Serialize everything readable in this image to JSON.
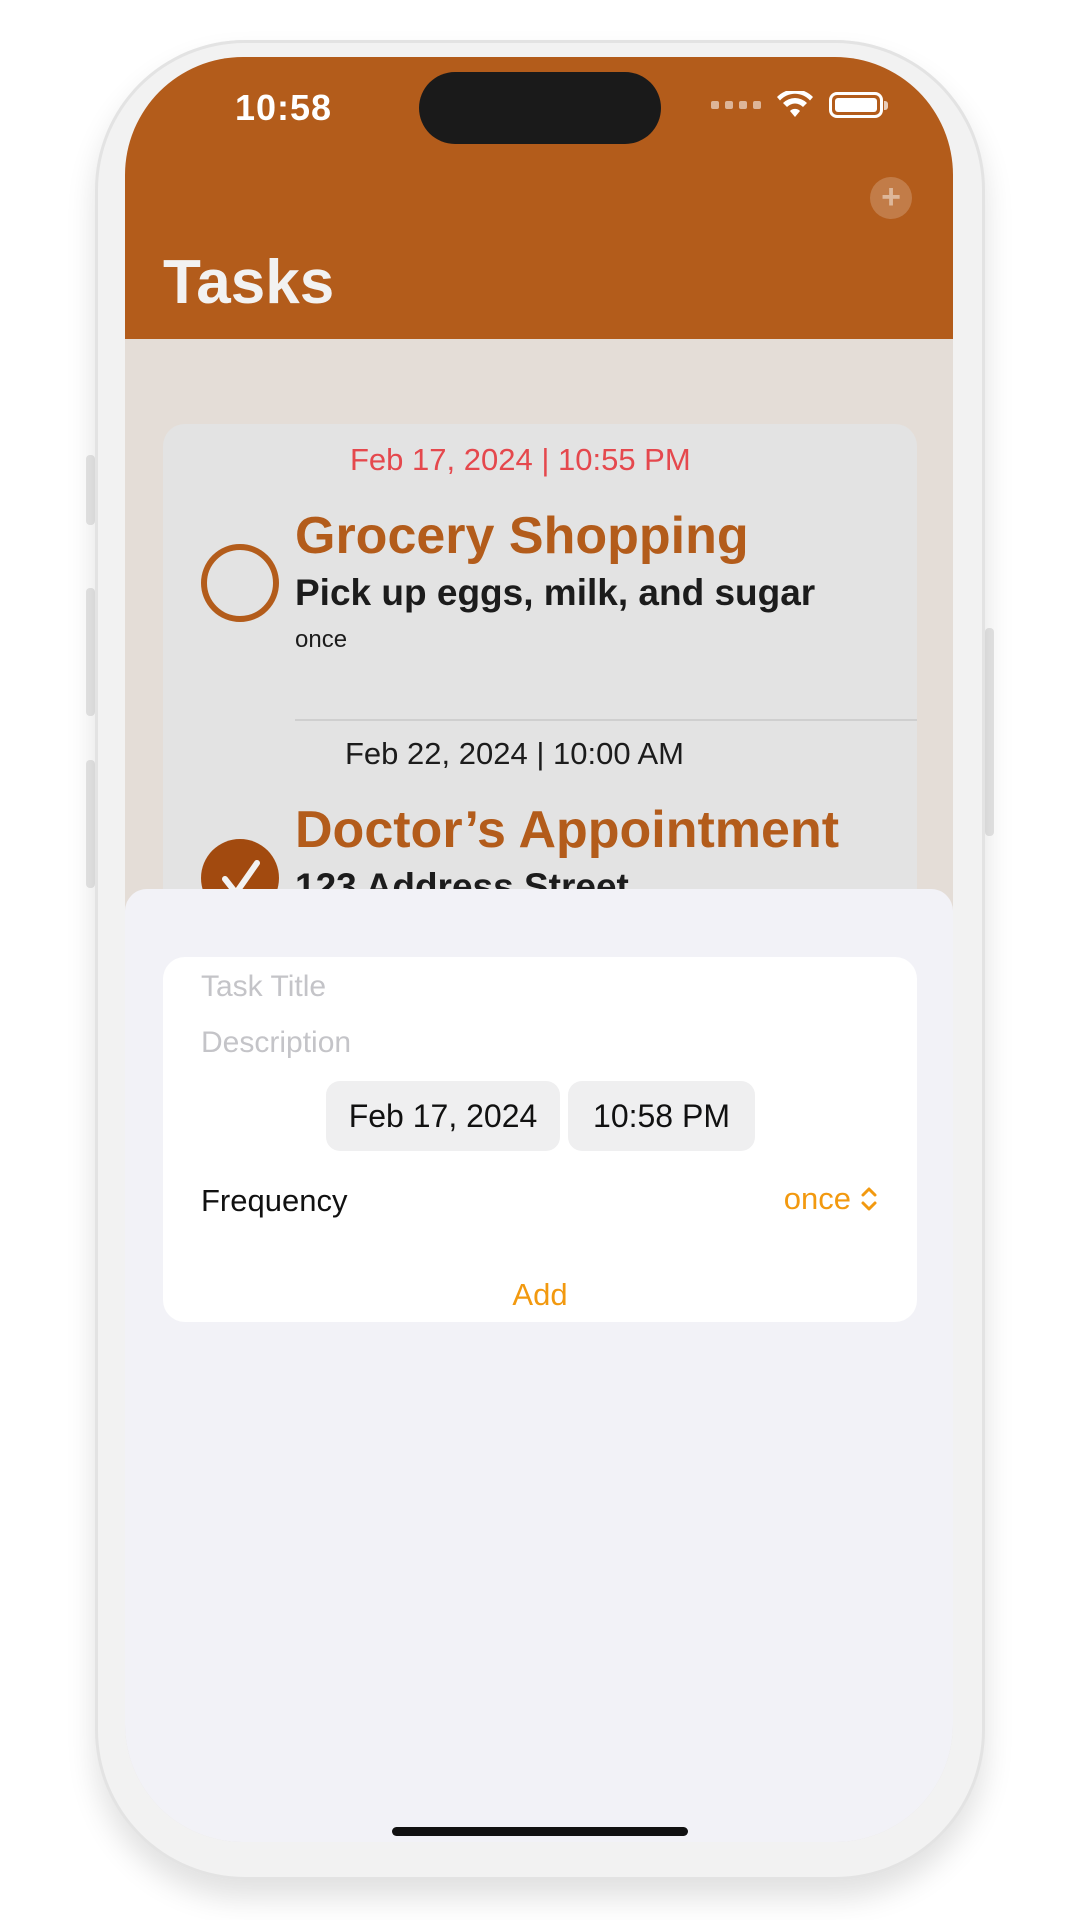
{
  "status_bar": {
    "time": "10:58"
  },
  "header": {
    "title": "Tasks",
    "add_icon": "plus-circle-icon"
  },
  "tasks": [
    {
      "date": "Feb 17, 2024 | 10:55 PM",
      "title": "Grocery Shopping",
      "description": "Pick up eggs, milk, and sugar",
      "frequency": "once",
      "completed": false,
      "date_color": "#e5484d"
    },
    {
      "date": "Feb 22, 2024 | 10:00 AM",
      "title": "Doctor’s Appointment",
      "description": "123 Address Street",
      "completed": true,
      "date_color": "#1c1c1c"
    }
  ],
  "form": {
    "title_placeholder": "Task Title",
    "description_placeholder": "Description",
    "date_value": "Feb 17, 2024",
    "time_value": "10:58 PM",
    "frequency_label": "Frequency",
    "frequency_value": "once",
    "add_label": "Add"
  },
  "colors": {
    "accent": "#b35c1b",
    "orange": "#f2990f"
  }
}
